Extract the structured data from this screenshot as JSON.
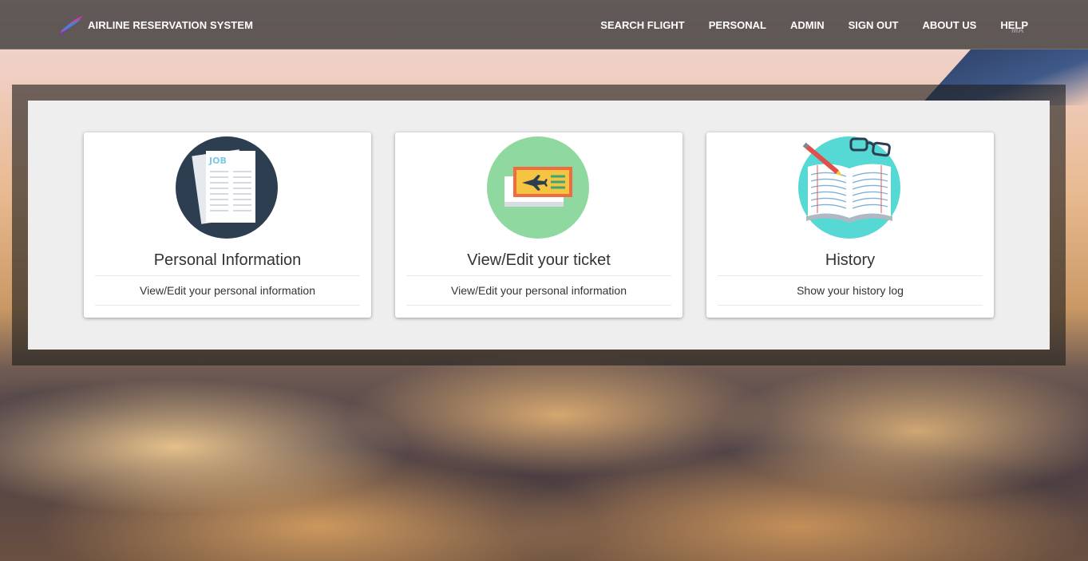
{
  "header": {
    "brand": "AIRLINE RESERVATION SYSTEM",
    "nav": [
      "SEARCH FLIGHT",
      "PERSONAL",
      "ADMIN",
      "SIGN OUT",
      "ABOUT US",
      "HELP"
    ],
    "watermark": "MA"
  },
  "cards": [
    {
      "title": "Personal Information",
      "description": "View/Edit your personal information",
      "icon": "job-document-icon",
      "icon_bg": "#2c3e50"
    },
    {
      "title": "View/Edit your ticket",
      "description": "View/Edit your personal information",
      "icon": "flight-ticket-icon",
      "icon_bg": "#8fd9a0"
    },
    {
      "title": "History",
      "description": "Show your history log",
      "icon": "open-book-glasses-icon",
      "icon_bg": "#56d8d4"
    }
  ],
  "icon_text": {
    "job": "JOB"
  },
  "colors": {
    "navbar_bg": "rgba(40,40,40,0.72)",
    "panel_bg": "#eeeeee",
    "card_bg": "#ffffff"
  }
}
